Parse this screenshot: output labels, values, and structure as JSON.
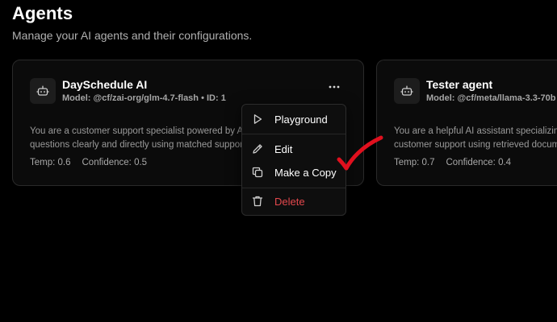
{
  "header": {
    "title": "Agents",
    "subtitle": "Manage your AI agents and their configurations."
  },
  "agents": [
    {
      "name": "DaySchedule AI",
      "model": "Model: @cf/zai-org/glm-4.7-flash • ID: 1",
      "description_lines": [
        "You are a customer support specialist powered by AI",
        "questions clearly and directly using matched support"
      ],
      "temp": "Temp: 0.6",
      "confidence": "Confidence: 0.5",
      "icon": "bot-icon",
      "more_label": "•••"
    },
    {
      "name": "Tester agent",
      "model": "Model: @cf/meta/llama-3.3-70b",
      "description_lines": [
        "You are a helpful AI assistant specializing",
        "customer support using retrieved documentation"
      ],
      "temp": "Temp: 0.7",
      "confidence": "Confidence: 0.4",
      "icon": "bot-icon"
    }
  ],
  "menu": {
    "items": [
      {
        "label": "Playground",
        "icon": "play-icon"
      },
      {
        "label": "Edit",
        "icon": "pencil-icon"
      },
      {
        "label": "Make a Copy",
        "icon": "copy-icon"
      },
      {
        "label": "Delete",
        "icon": "trash-icon",
        "color": "#e5484d"
      }
    ]
  },
  "annotation": {
    "checkmark_color": "#e0101e"
  }
}
